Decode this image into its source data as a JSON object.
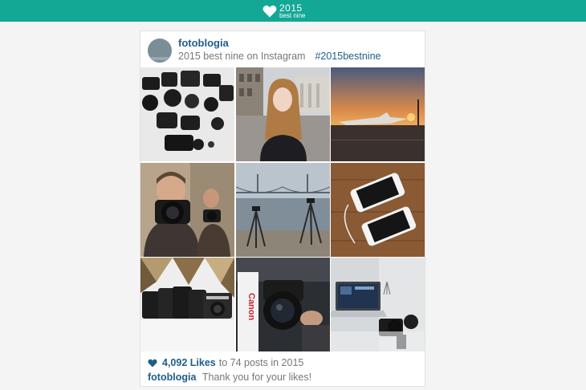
{
  "header": {
    "logo_icon": "heart-icon",
    "year": "2015",
    "subtitle": "best nine",
    "bar_color": "#13a795"
  },
  "card": {
    "username": "fotoblogia",
    "subtitle": "2015 best nine on Instagram",
    "hashtag": "#2015bestnine",
    "photos": [
      {
        "name": "photo-cameras-on-floor",
        "icon": "camera-collection-photo"
      },
      {
        "name": "photo-woman-portrait",
        "icon": "portrait-photo"
      },
      {
        "name": "photo-airport-sunset",
        "icon": "airplane-sunset-photo"
      },
      {
        "name": "photo-mirror-selfie",
        "icon": "mirror-selfie-photo"
      },
      {
        "name": "photo-bridge-tripods",
        "icon": "bridge-tripod-photo"
      },
      {
        "name": "photo-two-phones",
        "icon": "smartphones-photo"
      },
      {
        "name": "photo-cameras-lineup",
        "icon": "camera-lineup-photo"
      },
      {
        "name": "photo-canon-lens",
        "icon": "canon-lens-photo"
      },
      {
        "name": "photo-laptop-desk",
        "icon": "laptop-desk-photo"
      }
    ],
    "likes": {
      "count": "4,092 Likes",
      "rest": "to 74 posts in 2015"
    },
    "caption": {
      "user": "fotoblogia",
      "text": "Thank you for your likes!"
    },
    "accent_color": "#1f5d8b"
  }
}
